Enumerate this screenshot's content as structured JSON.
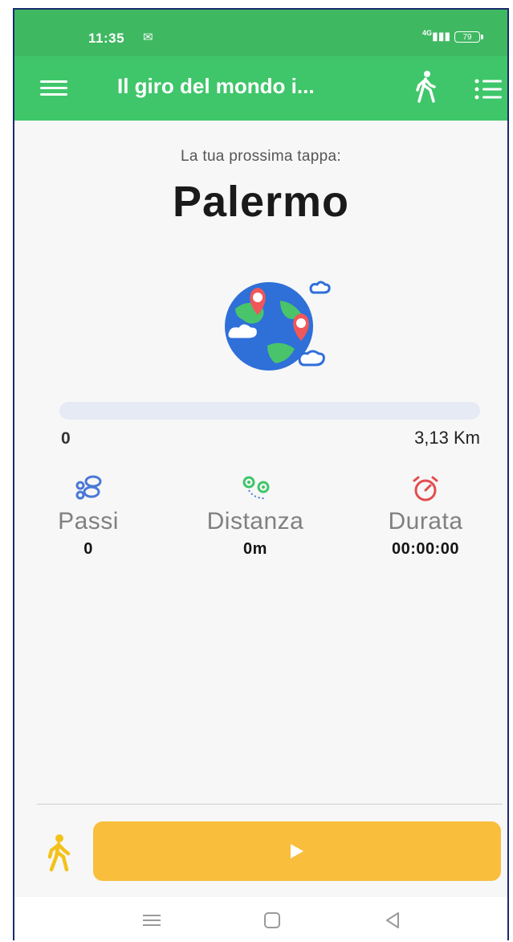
{
  "status_bar": {
    "time": "11:35",
    "mail_icon": "gmail-icon",
    "signal": "4G",
    "battery": "79"
  },
  "app_bar": {
    "title": "Il giro del mondo i...",
    "menu_icon": "hamburger-menu-icon",
    "walk_icon": "walking-person-icon",
    "list_icon": "list-icon",
    "background": "#3fc66a"
  },
  "main": {
    "subtitle": "La tua prossima tappa:",
    "destination": "Palermo",
    "illustration": "globe-with-pins-icon"
  },
  "progress": {
    "start_label": "0",
    "end_label": "3,13 Km",
    "fraction": 0
  },
  "stats": [
    {
      "icon": "footprints-icon",
      "label": "Passi",
      "value": "0",
      "color": "#4a78d6"
    },
    {
      "icon": "route-pins-icon",
      "label": "Distanza",
      "value": "0m",
      "color": "#3fc66a"
    },
    {
      "icon": "stopwatch-icon",
      "label": "Durata",
      "value": "00:00:00",
      "color": "#e34d4d"
    }
  ],
  "controls": {
    "walk_icon": "walking-person-icon",
    "play_icon": "play-icon",
    "accent": "#f8be3c"
  },
  "nav_bar": {
    "menu_icon": "recent-apps-icon",
    "home_icon": "home-icon",
    "back_icon": "back-icon"
  }
}
